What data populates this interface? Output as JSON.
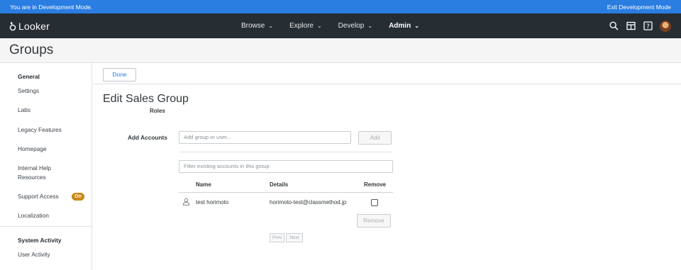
{
  "dev_bar": {
    "message": "You are in Development Mode.",
    "exit_label": "Exit Development Mode",
    "color": "#2a7de1"
  },
  "nav": {
    "brand": "Looker",
    "menus": [
      {
        "label": "Browse",
        "active": false
      },
      {
        "label": "Explore",
        "active": false
      },
      {
        "label": "Develop",
        "active": false
      },
      {
        "label": "Admin",
        "active": true
      }
    ],
    "icons": [
      "search-icon",
      "marketplace-icon",
      "help-icon",
      "avatar"
    ],
    "background": "#262d33"
  },
  "page": {
    "title": "Groups"
  },
  "sidebar": {
    "general_header": "General",
    "items": {
      "settings": "Settings",
      "labs": "Labs",
      "legacy": "Legacy Features",
      "homepage": "Homepage",
      "internal_help_1": "Internal Help",
      "internal_help_2": "Resources",
      "support_access": "Support Access",
      "localization": "Localization"
    },
    "support_badge": "On",
    "system_activity_header": "System Activity",
    "user_activity": "User Activity"
  },
  "toolbar": {
    "done_label": "Done"
  },
  "form": {
    "title": "Edit Sales Group",
    "roles_label": "Roles",
    "accounts_label": "Add Accounts",
    "add_placeholder": "Add group or user...",
    "add_button": "Add",
    "filter_placeholder": "Filter existing accounts in this group"
  },
  "table": {
    "columns": {
      "name": "Name",
      "details": "Details",
      "remove": "Remove"
    },
    "rows": [
      {
        "name": "test horimoto",
        "details": "horimoto-test@classmethod.jp",
        "remove": false
      }
    ],
    "remove_button": "Remove",
    "prev": "Prev",
    "next": "Next"
  }
}
